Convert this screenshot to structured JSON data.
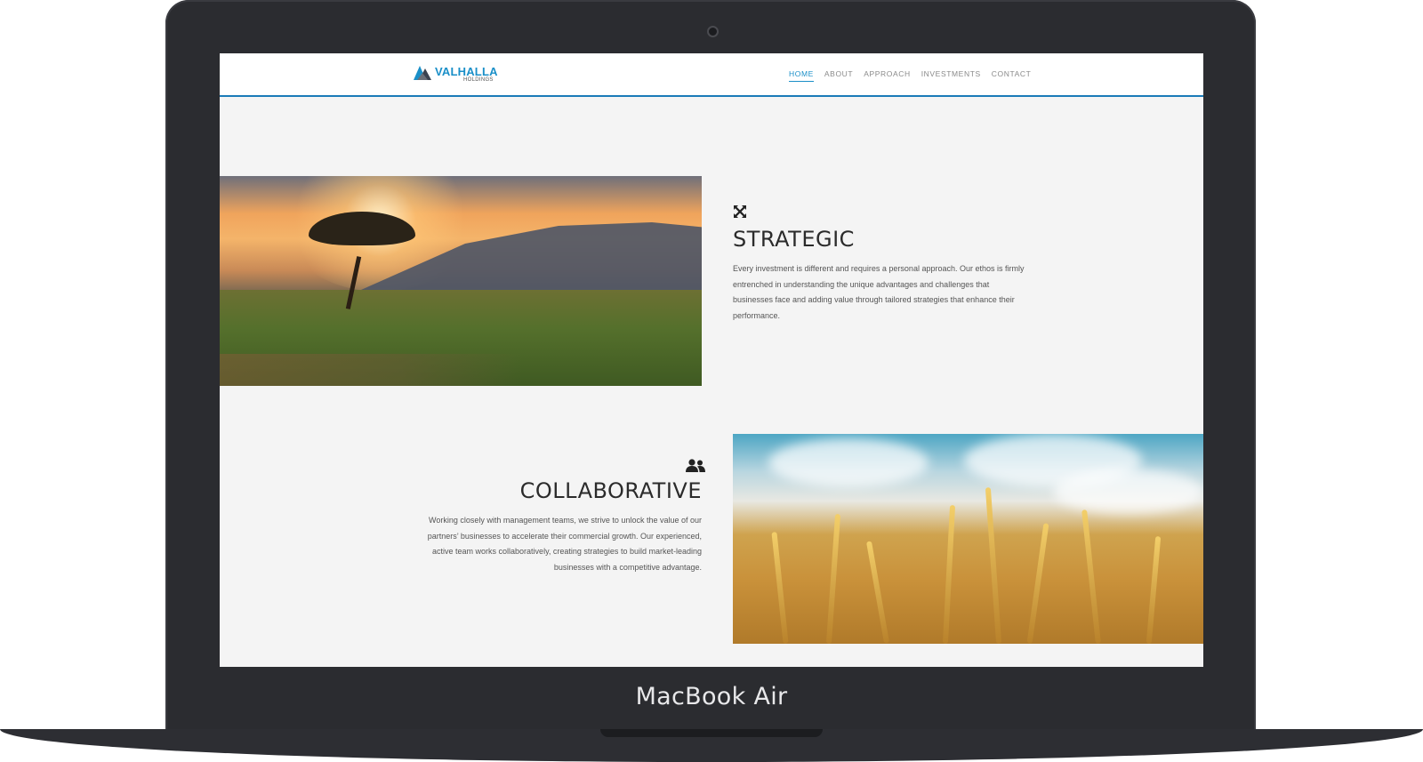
{
  "device": {
    "brand_label": "MacBook Air"
  },
  "site": {
    "logo": {
      "name": "VALHALLA",
      "sub": "HOLDINGS"
    },
    "nav": [
      {
        "label": "HOME",
        "active": true
      },
      {
        "label": "ABOUT",
        "active": false
      },
      {
        "label": "APPROACH",
        "active": false
      },
      {
        "label": "INVESTMENTS",
        "active": false
      },
      {
        "label": "CONTACT",
        "active": false
      }
    ],
    "accent_color": "#1a8fc8"
  },
  "sections": {
    "strategic": {
      "icon": "expand-arrows-icon",
      "title": "STRATEGIC",
      "text": "Every investment is different and requires a personal approach. Our ethos is firmly entrenched in understanding the unique advantages and challenges that businesses face and adding value through tailored strategies that enhance their performance.",
      "image": "savanna-sunset-image"
    },
    "collaborative": {
      "icon": "users-icon",
      "title": "COLLABORATIVE",
      "text": "Working closely with management teams, we strive to unlock the value of our partners’ businesses to accelerate their commercial growth. Our experienced, active team works collaboratively, creating strategies to build market-leading businesses with a competitive advantage.",
      "image": "wheat-field-image"
    }
  }
}
